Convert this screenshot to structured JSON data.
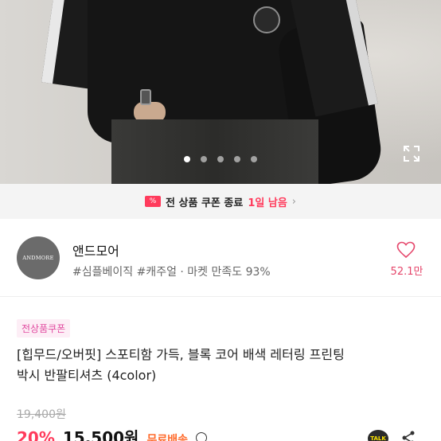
{
  "hero": {
    "slide_count": 5,
    "active_slide": 1,
    "expand_icon": "expand-icon"
  },
  "coupon_banner": {
    "icon": "coupon-icon",
    "icon_text": "%",
    "text": "전 상품 쿠폰 종료",
    "remaining": "1일 남음",
    "chevron": "chevron-right-icon"
  },
  "shop": {
    "logo_text": "ANDMORE",
    "name": "앤드모어",
    "tags": "#심플베이직 #캐주얼 · 마켓 만족도 93%",
    "likes": "52.1만",
    "heart_icon": "heart-icon"
  },
  "product": {
    "badge": "전상품쿠폰",
    "title_line1": "[힙무드/오버핏] 스포티함 가득, 블록 코어 배색 레터링 프린팅",
    "title_line2": "박시 반팔티셔츠 (4color)",
    "original_price": "19,400원",
    "discount": "20%",
    "price": "15,500원",
    "shipping": "무료배송",
    "talk_label": "TALK"
  },
  "colors": {
    "accent": "#ff3b5c",
    "likes": "#e5456a",
    "badge_bg": "#fdeef6",
    "badge_text": "#e14ba0",
    "shipping": "#ff6b2c"
  }
}
